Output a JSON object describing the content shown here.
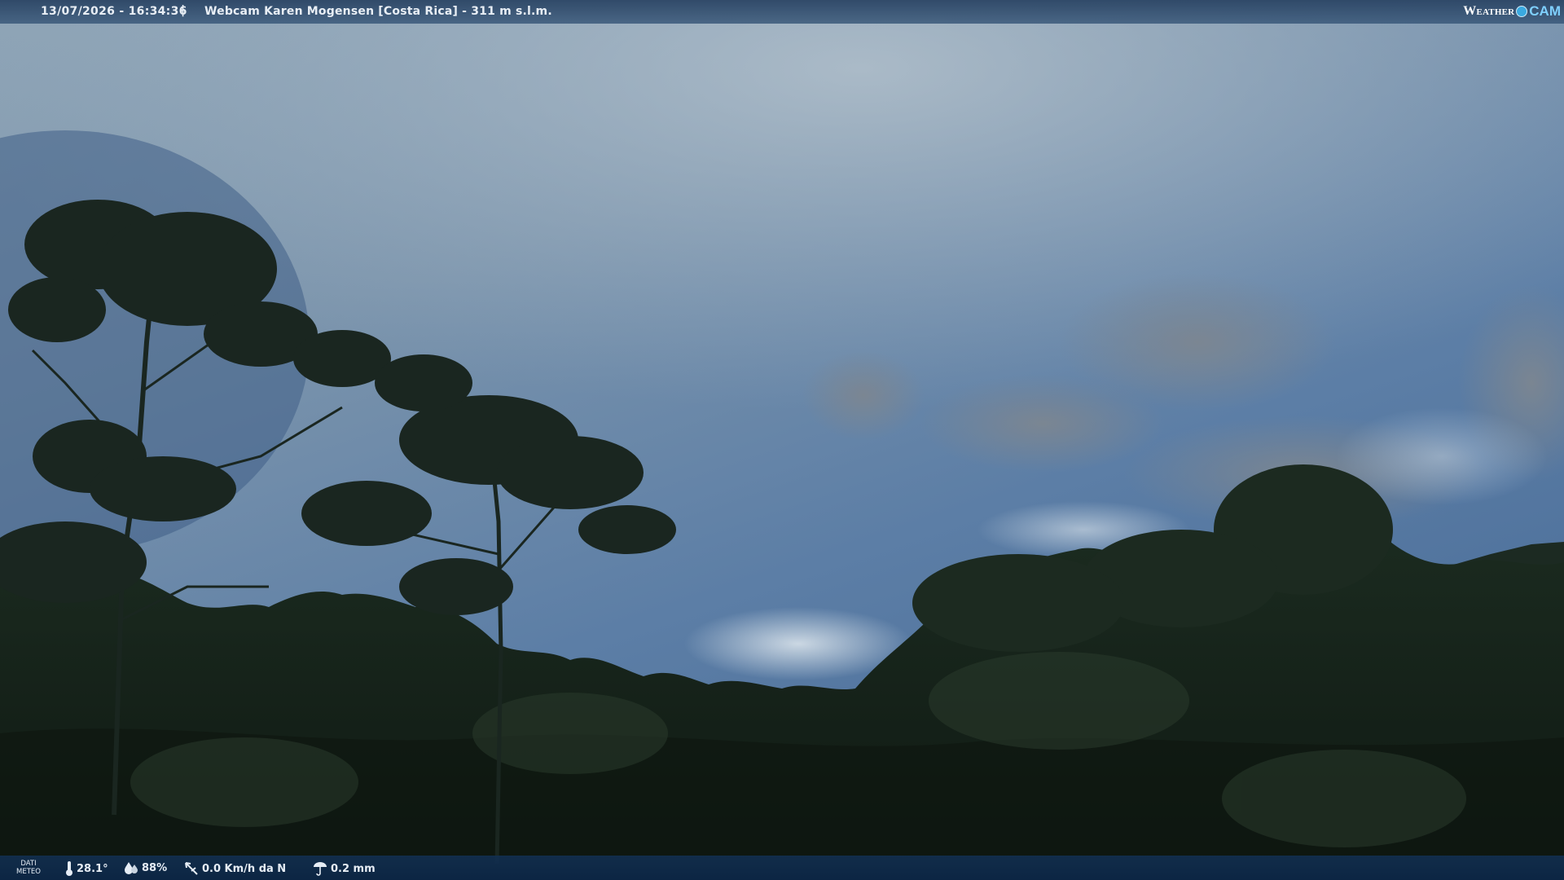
{
  "header": {
    "timestamp": "13/07/2026 - 16:34:36",
    "separator": "|",
    "title": "Webcam Karen Mogensen [Costa Rica]  - 311 m s.l.m.",
    "logo_text_left": "Weather",
    "logo_text_right": "CAM"
  },
  "weather": {
    "section_label_line1": "DATI",
    "section_label_line2": "METEO",
    "temperature": "28.1°",
    "humidity": "88%",
    "wind": "0.0 Km/h da N",
    "rain": "0.2 mm",
    "icons": [
      "thermometer-icon",
      "humidity-drop-icon",
      "wind-vane-icon",
      "rain-gauge-icon"
    ]
  },
  "colors": {
    "sky_top": "#8fa4b8",
    "sky_mid": "#6f8fb0",
    "sky_blue": "#4f77a8",
    "forest_dark": "#131f17",
    "bar_blue": "#1b3b63",
    "logo_accent": "#7fd0ff"
  }
}
